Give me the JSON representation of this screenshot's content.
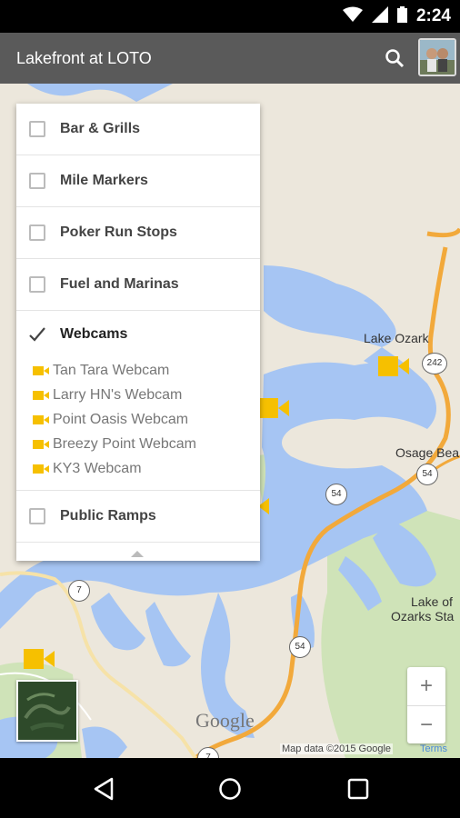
{
  "status_bar": {
    "time": "2:24",
    "icons": [
      "wifi-icon",
      "signal-icon",
      "battery-icon"
    ]
  },
  "app_bar": {
    "title": "Lakefront at LOTO",
    "search_icon": "search-icon",
    "avatar": "avatar"
  },
  "layers": [
    {
      "label": "Bar & Grills",
      "checked": false
    },
    {
      "label": "Mile Markers",
      "checked": false
    },
    {
      "label": "Poker Run Stops",
      "checked": false
    },
    {
      "label": "Fuel and Marinas",
      "checked": false
    }
  ],
  "webcams": {
    "label": "Webcams",
    "checked": true,
    "items": [
      "Tan Tara Webcam",
      "Larry HN's Webcam",
      "Point Oasis Webcam",
      "Breezy Point Webcam",
      "KY3 Webcam"
    ]
  },
  "public_ramps": {
    "label": "Public Ramps",
    "checked": false
  },
  "map": {
    "labels": {
      "lake_ozark": "Lake Ozark",
      "osage_beach": "Osage Bea",
      "park_line1": "Lake of",
      "park_line2": "Ozarks Sta"
    },
    "shields": {
      "r242": "242",
      "r54a": "54",
      "r54b": "54",
      "r54c": "54",
      "r7a": "7",
      "r7b": "7"
    },
    "logo": "Google",
    "attribution": "Map data ©2015 Google",
    "terms": "Terms"
  },
  "zoom": {
    "in": "+",
    "out": "−"
  },
  "colors": {
    "water": "#a6c5f3",
    "land": "#ece7dc",
    "park": "#cfe3b8",
    "road": "#f2a93b",
    "marker": "#f6c000",
    "app_bar": "#5a5a5a"
  }
}
